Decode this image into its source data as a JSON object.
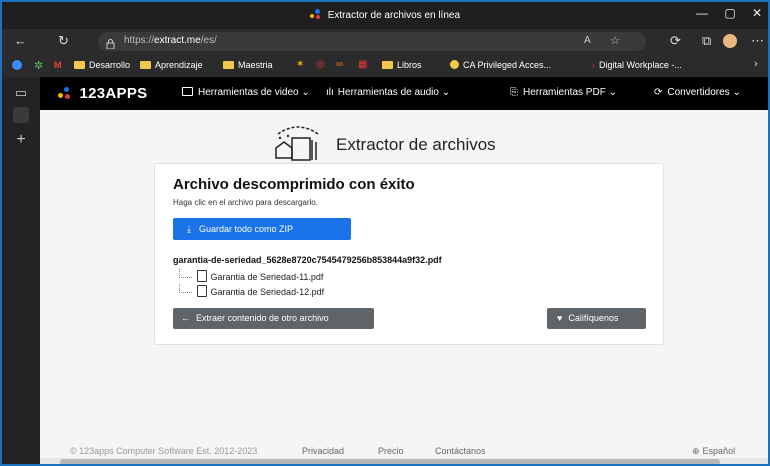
{
  "window": {
    "title": "Extractor de archivos en línea",
    "minimize": "—",
    "maximize": "▢",
    "close": "✕"
  },
  "address": {
    "url_prefix": "https://",
    "url_domain": "extract.me",
    "url_path": "/es/"
  },
  "bookmarks": [
    "Desarrollo",
    "Aprendizaje",
    "Maestria",
    "Libros",
    "CA Privileged Acces...",
    "Digital Workplace -..."
  ],
  "app_nav": {
    "logo": "123APPS",
    "items": [
      "Herramientas de video",
      "Herramientas de audio",
      "Herramientas PDF",
      "Convertidores"
    ]
  },
  "hero": {
    "title": "Extractor de archivos"
  },
  "result": {
    "heading": "Archivo descomprimido con éxito",
    "subtitle": "Haga clic en el archivo para descargarlo.",
    "save_all_label": "Guardar todo como ZIP",
    "archive_name": "garantia-de-seriedad_5628e8720c7545479256b853844a9f32.pdf",
    "files": [
      "Garantia de Seriedad-11.pdf",
      "Garantia de Seriedad-12.pdf"
    ],
    "extract_other_label": "Extraer contenido de otro archivo",
    "rate_label": "Califíquenos"
  },
  "footer": {
    "copyright": "© 123apps Computer Software Est. 2012-2023",
    "links": [
      "Privacidad",
      "Precio",
      "Contáctanos"
    ],
    "language": "Español"
  },
  "colors": {
    "primary_button": "#1a73e8",
    "secondary_button": "#5e6467",
    "browser_chrome": "#2b2b2b",
    "window_border": "#1e73be"
  }
}
